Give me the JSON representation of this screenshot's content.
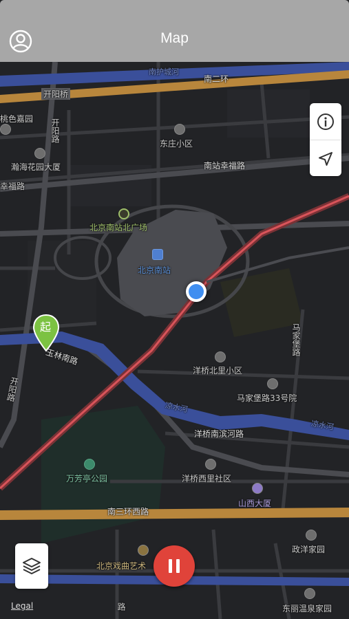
{
  "header": {
    "title": "Map",
    "avatar_icon": "user-circle-icon"
  },
  "controls": {
    "info_icon": "info-icon",
    "locate_icon": "navigation-arrow-icon",
    "layers_icon": "layers-icon",
    "pause_icon": "pause-icon"
  },
  "legal_label": "Legal",
  "start_marker_label": "起",
  "map_labels": {
    "kaiyang_bridge": "开阳桥",
    "kaiyang_road": "开阳路",
    "kaiyang_road_2": "开阳路",
    "huchenghe": "南护城河",
    "second_ring": "南二环",
    "taoseyuan": "桃色嘉园",
    "dongzhuang": "东庄小区",
    "hanhai": "瀚海花园大厦",
    "nanzhan_xingfu": "南站幸福路",
    "xingfu_road": "幸福路",
    "north_square": "北京南站北广场",
    "south_station": "北京南站",
    "yulin_south": "玉林南路",
    "yangqiao_north": "洋桥北里小区",
    "majiapu_road": "马家堡路",
    "majiapu_33": "马家堡路33号院",
    "liangshui_1": "凉水河",
    "liangshui_2": "凉水河",
    "yangqiao_binhe": "洋桥南滨河路",
    "wanfangting": "万芳亭公园",
    "yangqiao_xili": "洋桥西里社区",
    "shanxi_tower": "山西大厦",
    "third_ring_west": "南三环西路",
    "zhengxiang": "政洋家园",
    "opera_art": "北京戏曲艺术",
    "dongli": "东丽温泉家园",
    "bottom_road": "路"
  },
  "colors": {
    "header_bg": "#a7a7a7",
    "map_bg": "#222326",
    "ring_road": "#b8863c",
    "river": "#3a4f9a",
    "rail": "#d9545a",
    "location_dot": "#3f8ef0",
    "pause_button": "#e0433a",
    "start_pin": "#7cc242"
  }
}
